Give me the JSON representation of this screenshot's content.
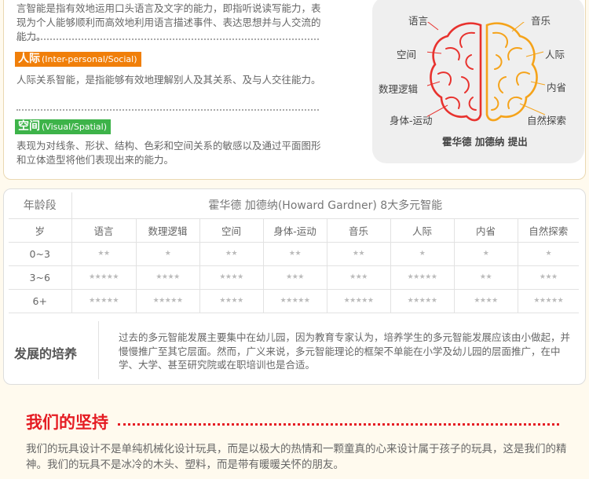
{
  "intro": {
    "text": "言智能是指有效地运用口头语言及文字的能力，即指听说读写能力，表现为个人能够顺利而高效地利用语言描述事件、表达思想并与人交流的能力。"
  },
  "interpersonal": {
    "tag_cn": "人际",
    "tag_en": "(Inter-personal/Social)",
    "desc": "人际关系智能，是指能够有效地理解别人及其关系、及与人交往能力。"
  },
  "spatial": {
    "tag_cn": "空间",
    "tag_en": "(Visual/Spatial)",
    "desc": "表现为对线条、形状、结构、色彩和空间关系的敏感以及通过平面图形和立体造型将他们表现出来的能力。"
  },
  "brain": {
    "labels_left": [
      "语言",
      "空间",
      "数理逻辑",
      "身体-运动"
    ],
    "labels_right": [
      "音乐",
      "人际",
      "内省",
      "自然探索"
    ],
    "caption": "霍华德 加德纳 提出",
    "left_color": "#e8322e",
    "right_color": "#f5a31a"
  },
  "table": {
    "age_header": "年龄段",
    "title": "霍华德 加德纳(Howard Gardner)   8大多元智能",
    "unit_label": "岁",
    "columns": [
      "语言",
      "数理逻辑",
      "空间",
      "身体-运动",
      "音乐",
      "人际",
      "内省",
      "自然探索"
    ],
    "rows": [
      {
        "age": "0~3",
        "stars": [
          2,
          1,
          2,
          2,
          2,
          1,
          1,
          1
        ]
      },
      {
        "age": "3~6",
        "stars": [
          5,
          4,
          4,
          3,
          3,
          5,
          2,
          3
        ]
      },
      {
        "age": "6+",
        "stars": [
          5,
          5,
          4,
          5,
          5,
          5,
          4,
          5
        ]
      }
    ],
    "star_char": "★"
  },
  "development": {
    "label": "发展的培养",
    "text": "过去的多元智能发展主要集中在幼儿园，因为教育专家认为，培养学生的多元智能发展应该由小做起，并慢慢推广至其它层面。然而，广义来说，多元智能理论的框架不单能在小学及幼儿园的层面推广，在中学、大学、甚至研究院或在职培训也是合适。"
  },
  "insist": {
    "title": "我们的坚持",
    "text": "我们的玩具设计不是单纯机械化设计玩具，而是以极大的热情和一颗童真的心来设计属于孩子的玩具，这是我们的精神。我们的玩具不是冰冷的木头、塑料，而是带有暖暖关怀的朋友。",
    "accent": "#e51c23"
  }
}
